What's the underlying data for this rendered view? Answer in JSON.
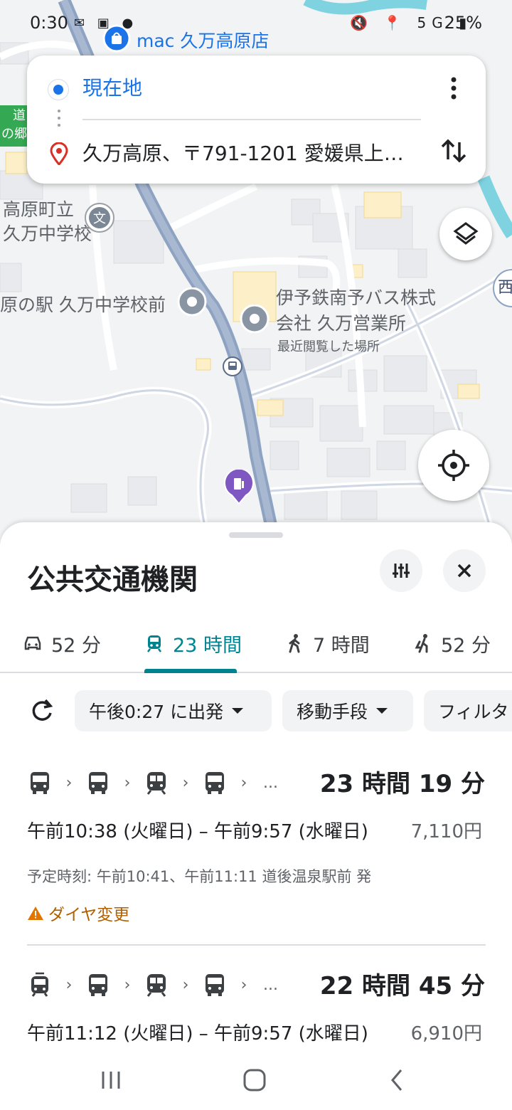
{
  "status_bar": {
    "time": "0:30",
    "battery": "25%",
    "left_icons": "✉ ▣ ●",
    "right_icons": "🔇 📍 5G ▮"
  },
  "map": {
    "top_place": "mac 久万高原店",
    "labels": {
      "school": [
        "高原町立",
        "久万中学校"
      ],
      "station": "原の駅 久万中学校前",
      "bus_company": [
        "伊予鉄南予バス株式",
        "会社 久万営業所"
      ],
      "recent": "最近閲覧した場所",
      "road_green": [
        "道",
        "の郷"
      ],
      "west_char": "西"
    }
  },
  "route": {
    "origin": "現在地",
    "destination": "久万高原、〒791-1201 愛媛県上…"
  },
  "sheet": {
    "title": "公共交通機関",
    "tabs": [
      {
        "icon": "car-icon",
        "label": "52 分"
      },
      {
        "icon": "train-icon",
        "label": "23 時間"
      },
      {
        "icon": "walk-icon",
        "label": "7 時間"
      },
      {
        "icon": "ride-icon",
        "label": "52 分"
      }
    ],
    "filters": {
      "depart": "午後0:27 に出発",
      "modes": "移動手段",
      "filter": "フィルタ"
    },
    "results": [
      {
        "duration": "23 時間 19 分",
        "timerange": "午前10:38 (火曜日) – 午前9:57 (水曜日)",
        "fare": "7,110円",
        "schedule": "予定時刻: 午前10:41、午前11:11 道後温泉駅前 発",
        "alert": "ダイヤ変更",
        "ellipsis": "..."
      },
      {
        "duration": "22 時間 45 分",
        "timerange": "午前11:12 (火曜日) – 午前9:57 (水曜日)",
        "fare": "6,910円",
        "ellipsis": "..."
      }
    ]
  },
  "colors": {
    "accent_blue": "#1a73e8",
    "teal": "#00838f",
    "warning": "#b06000"
  }
}
